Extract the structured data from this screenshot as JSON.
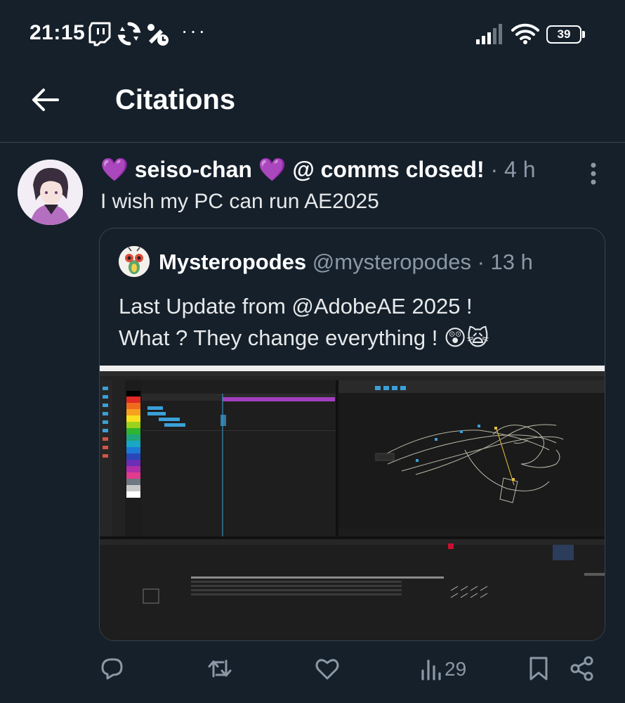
{
  "status_bar": {
    "time": "21:15",
    "notification_icons": [
      "twitch-icon",
      "sync-icon",
      "do-not-disturb-icon"
    ],
    "more_dots": "···",
    "battery_percent": "39"
  },
  "header": {
    "title": "Citations"
  },
  "tweet": {
    "display_name": "💜 seiso-chan 💜 @ comms closed!",
    "separator": " · ",
    "time_ago": "4 h",
    "text": "I wish my PC can run AE2025"
  },
  "quoted_tweet": {
    "display_name": "Mysteropodes",
    "handle": "@mysteropodes",
    "separator": " · ",
    "time_ago": "13 h",
    "text_line1": "Last Update from @AdobeAE 2025 !",
    "text_line2": "What ? They change everything ! 😲🙀",
    "media_description_icon": "after-effects-screenshot"
  },
  "actions": {
    "views_count": "29"
  },
  "colors": {
    "background": "#15202b",
    "text_primary": "#e7e9ea",
    "text_secondary": "#8b98a5",
    "border": "#38444d"
  }
}
